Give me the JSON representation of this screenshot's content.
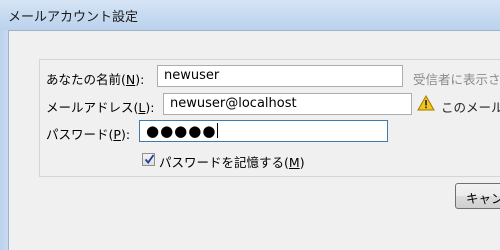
{
  "window": {
    "title": "メールアカウント設定"
  },
  "form": {
    "name": {
      "label": "あなたの名前(",
      "accesskey": "N",
      "label_suffix": "):",
      "value": "newuser",
      "note": "受信者に表示され"
    },
    "email": {
      "label": "メールアドレス(",
      "accesskey": "L",
      "label_suffix": "):",
      "value": "newuser@localhost",
      "warning_icon": "warning-triangle-icon",
      "note": "このメール"
    },
    "password": {
      "label": "パスワード(",
      "accesskey": "P",
      "label_suffix": "):",
      "masked_value": "●●●●●"
    },
    "remember_password": {
      "checked": true,
      "label": "パスワードを記憶する(",
      "accesskey": "M",
      "label_suffix": ")"
    }
  },
  "buttons": {
    "cancel_label": "キャン"
  },
  "colors": {
    "titlebar": "#c4d8ef",
    "panel": "#f0f0f0",
    "warning": "#f5c518",
    "checkmark": "#1f3f8f"
  }
}
